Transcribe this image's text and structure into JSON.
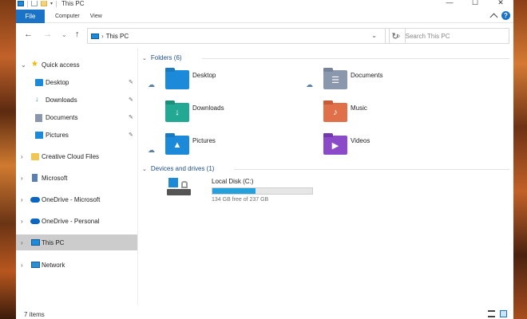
{
  "title_bar": {
    "title": "This PC",
    "controls": [
      "—",
      "☐",
      "✕"
    ]
  },
  "ribbon": {
    "file_label": "File",
    "tabs": [
      "Computer",
      "View"
    ],
    "help": "?"
  },
  "address": {
    "path": "This PC",
    "search_placeholder": "Search This PC"
  },
  "sidebar": {
    "items": [
      {
        "label": "Quick access",
        "icon": "star-icon",
        "level": 0,
        "expanded": true
      },
      {
        "label": "Desktop",
        "icon": "desktop-folder-icon",
        "level": 1,
        "pinned": true
      },
      {
        "label": "Downloads",
        "icon": "download-icon",
        "level": 1,
        "pinned": true
      },
      {
        "label": "Documents",
        "icon": "documents-icon",
        "level": 1,
        "pinned": true
      },
      {
        "label": "Pictures",
        "icon": "pictures-icon",
        "level": 1,
        "pinned": true
      },
      {
        "label": "Creative Cloud Files",
        "icon": "creative-cloud-icon",
        "level": 0
      },
      {
        "label": "Microsoft",
        "icon": "building-icon",
        "level": 0
      },
      {
        "label": "OneDrive - Microsoft",
        "icon": "onedrive-icon",
        "level": 0
      },
      {
        "label": "OneDrive - Personal",
        "icon": "onedrive-icon",
        "level": 0
      },
      {
        "label": "This PC",
        "icon": "pc-icon",
        "level": 0,
        "selected": true
      },
      {
        "label": "Network",
        "icon": "network-icon",
        "level": 0
      }
    ]
  },
  "main": {
    "folders_header": "Folders (6)",
    "folders": [
      {
        "label": "Desktop",
        "color": "#1c8ad8",
        "cloud": true,
        "glyph": ""
      },
      {
        "label": "Documents",
        "color": "#8a97ad",
        "cloud": true,
        "glyph": "☰"
      },
      {
        "label": "Downloads",
        "color": "#23a893",
        "cloud": false,
        "glyph": "↓"
      },
      {
        "label": "Music",
        "color": "#e0704a",
        "cloud": false,
        "glyph": "♪"
      },
      {
        "label": "Pictures",
        "color": "#1c8ad8",
        "cloud": true,
        "glyph": "▲"
      },
      {
        "label": "Videos",
        "color": "#8b4bc8",
        "cloud": false,
        "glyph": "▶"
      }
    ],
    "drives_header": "Devices and drives (1)",
    "drive": {
      "label": "Local Disk (C:)",
      "free_text": "134 GB free of 237 GB",
      "used_fraction": 0.435,
      "bar_color": "#26a0da"
    }
  },
  "status": {
    "items_text": "7 items"
  }
}
